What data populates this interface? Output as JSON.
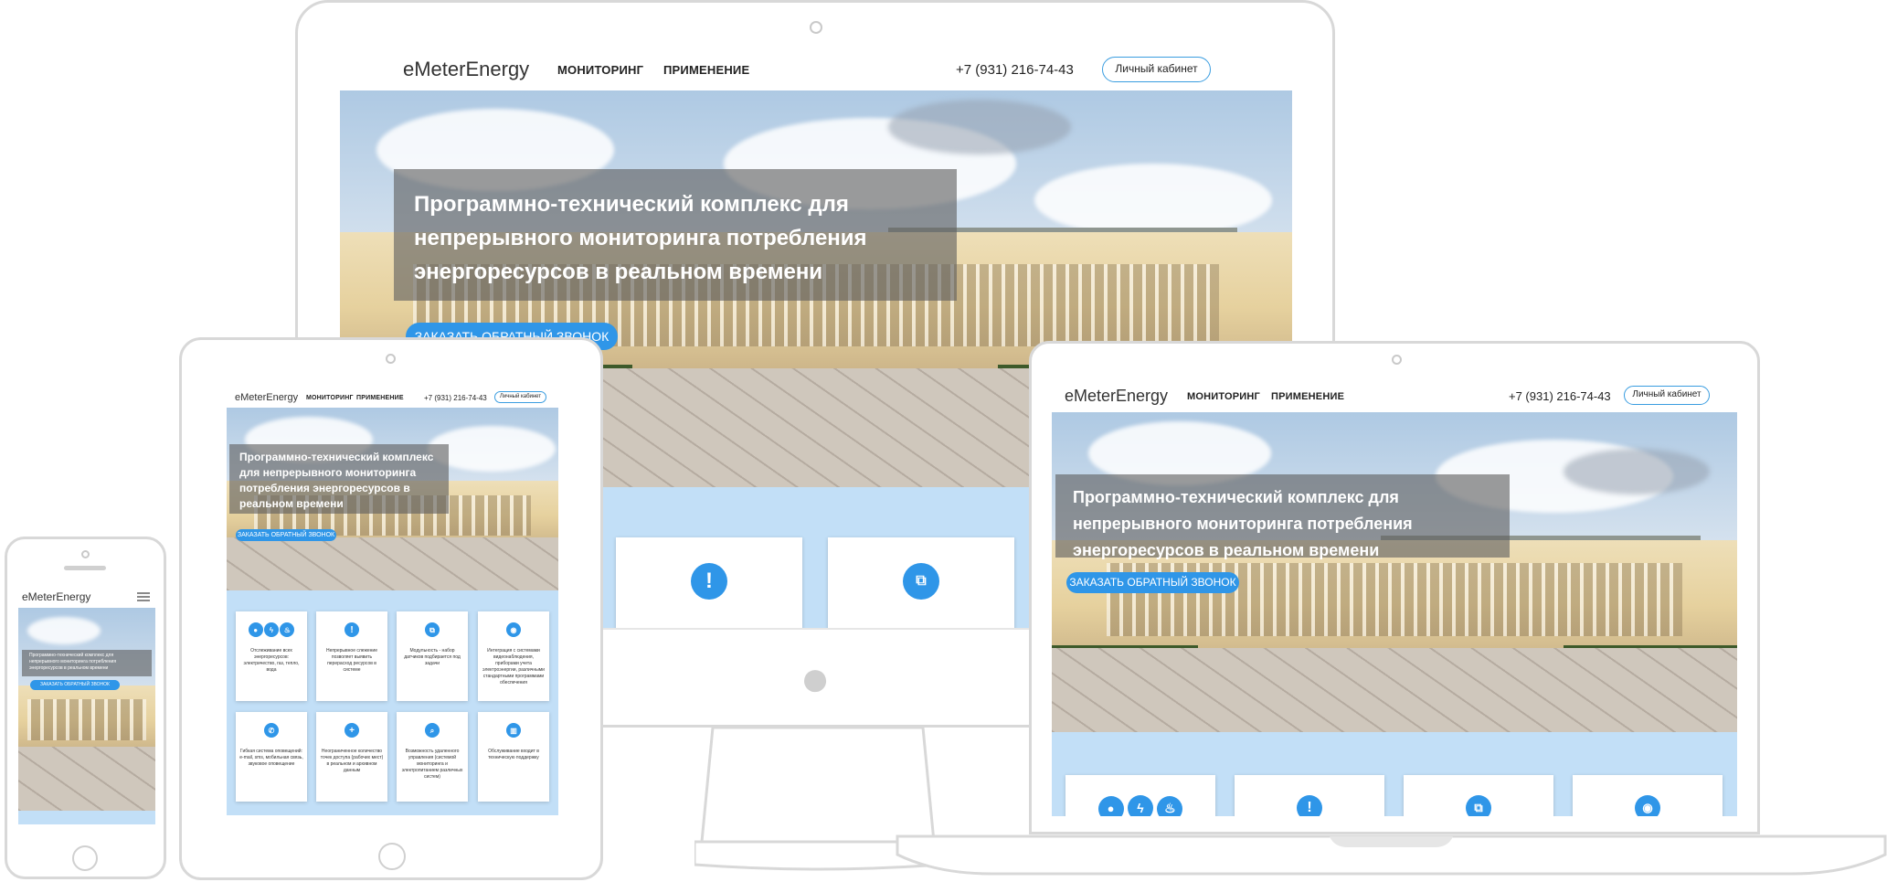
{
  "site": {
    "logo": "eMeterEnergy",
    "nav_monitoring": "МОНИТОРИНГ",
    "nav_application": "ПРИМЕНЕНИЕ",
    "phone": "+7 (931) 216-74-43",
    "cabinet": "Личный кабинет",
    "hero_title": "Программно-технический комплекс для непрерывного мониторинга потребления энергоресурсов в реальном времени",
    "hero_title_lines": [
      "Программно-технический комплекс для",
      "непрерывного мониторинга потребления",
      "энергоресурсов в реальном времени"
    ],
    "ipad_title_lines": [
      "Программно-технический комплекс",
      "для непрерывного мониторинга",
      "потребления энергоресурсов в",
      "реальном времени"
    ],
    "phone_title_lines": [
      "Программно-технический комплекс для",
      "непрерывного мониторинга потребления",
      "энергоресурсов в реальном времени"
    ],
    "cta": "ЗАКАЗАТЬ ОБРАТНЫЙ ЗВОНОК"
  },
  "features": [
    {
      "icon": "resource-icons",
      "text": "Отслеживание всех энергоресурсов: электричество, газ, тепло, вода"
    },
    {
      "icon": "alert-icon",
      "text": "Непрерывное слежение позволяет выявить перерасход ресурсов в системе"
    },
    {
      "icon": "module-icon",
      "text": "Модульность - набор датчиков подбирается под задачи"
    },
    {
      "icon": "integration-icon",
      "text": "Интеграция с системами видеонаблюдения, приборами учета электроэнергии, различными стандартными программами обеспечения"
    },
    {
      "icon": "phone-icon",
      "text": "Гибкая система оповещений: e-mail, sms, мобильная связь, звуковое оповещение"
    },
    {
      "icon": "plus-icon",
      "text": "Неограниченное количество точек доступа (рабочих мест) в реальном и архивном данным"
    },
    {
      "icon": "search-icon",
      "text": "Возможность удаленного управления (системой мониторинга и электропитанием различных систем)"
    },
    {
      "icon": "chart-icon",
      "text": "Обслуживание входит в техническую поддержку"
    }
  ],
  "colors": {
    "accent": "#2f96e8",
    "feature_bg": "#c2dff7",
    "device_frame": "#d8d8d8"
  }
}
